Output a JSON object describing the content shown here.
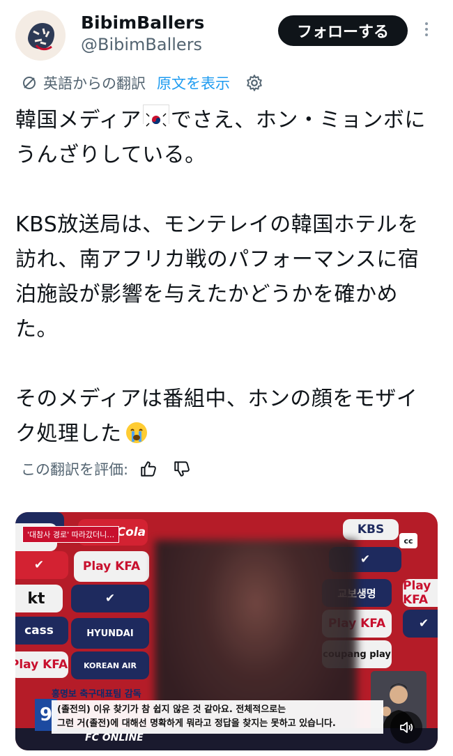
{
  "author": {
    "name": "BibimBallers",
    "handle": "@BibimBallers"
  },
  "actions": {
    "follow_label": "フォローする"
  },
  "translation": {
    "note": "英語からの翻訳",
    "show_original": "原文を表示"
  },
  "post": {
    "p1_before_flag": "韓国メディア",
    "p1_after_flag": "でさえ、ホン・ミョンボにうんざりしている。",
    "p2": "KBS放送局は、モンテレイの韓国ホテルを訪れ、南アフリカ戦のパフォーマンスに宿泊施設が影響を与えたかどうかを確かめた。",
    "p3": "そのメディアは番組中、ホンの顔をモザイク処理した"
  },
  "rating": {
    "label": "この翻訳を評価:"
  },
  "media": {
    "top_tag": "'대참사 경로' 따라갔더니…",
    "corner_brand": "KBS",
    "cc_label": "cc",
    "caption_name": "홍명보 축구대표팀 감독",
    "subtitle_line1": "(졸전의) 이유 찾기가 참 쉽지 않은 것 같아요. 전체적으로는",
    "subtitle_line2": "그런 거(졸전)에 대해선 명확하게 뭐라고 정답을 찾지는 못하고 있습니다.",
    "channel_number": "9",
    "sponsors": {
      "playkfa": "Play KFA",
      "hyundai": "HYUNDAI",
      "korean_air": "KOREAN AIR",
      "coupang": "coupang play",
      "kyobo": "교보생명",
      "kt": "kt",
      "cass": "cass",
      "fc_online": "FC ONLINE",
      "coca_cola": "Coca-Cola"
    }
  },
  "colors": {
    "accent": "#1d9bf0",
    "text": "#0f1419",
    "muted": "#536471",
    "follow_bg": "#0f1419"
  }
}
